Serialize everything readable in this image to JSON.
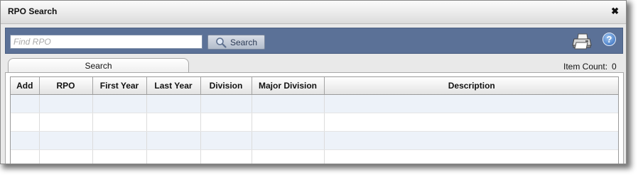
{
  "window": {
    "title": "RPO Search"
  },
  "toolbar": {
    "search_placeholder": "Find RPO",
    "search_value": "",
    "search_button_label": "Search",
    "help_label": "?"
  },
  "tabs": [
    {
      "label": "Search"
    }
  ],
  "status": {
    "item_count_label": "Item Count:",
    "item_count_value": "0"
  },
  "grid": {
    "columns": [
      "Add",
      "RPO",
      "First Year",
      "Last Year",
      "Division",
      "Major Division",
      "Description"
    ],
    "rows": []
  },
  "colors": {
    "toolbar_bg": "#5b7197",
    "row_alt": "#edf2f9"
  },
  "icons": {
    "close": "close-icon",
    "search": "magnifier-icon",
    "print": "printer-icon",
    "help": "help-icon"
  }
}
